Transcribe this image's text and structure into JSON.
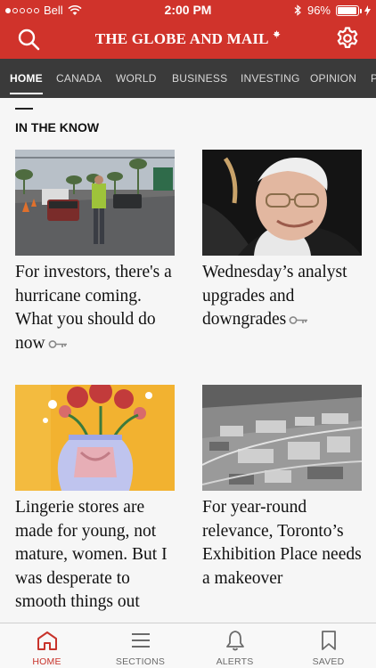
{
  "status": {
    "carrier": "Bell",
    "time": "2:00 PM",
    "battery": "96%",
    "battery_level": 0.96
  },
  "header": {
    "title": "THE GLOBE AND MAIL"
  },
  "tabs": [
    {
      "label": "HOME",
      "active": true
    },
    {
      "label": "CANADA"
    },
    {
      "label": "WORLD"
    },
    {
      "label": "BUSINESS"
    },
    {
      "label": "INVESTING"
    },
    {
      "label": "OPINION"
    },
    {
      "label": "P"
    }
  ],
  "section": {
    "title": "IN THE KNOW"
  },
  "articles": [
    {
      "headline": "For investors, there's a hurricane coming. What you should do now",
      "premium": true,
      "image": "hurricane-road-photo"
    },
    {
      "headline": "Wednesday’s analyst upgrades and downgrades",
      "premium": true,
      "image": "portrait-photo"
    },
    {
      "headline": "Lingerie stores are made for young, not mature, women. But I was desperate to smooth things out",
      "premium": false,
      "image": "lingerie-illustration"
    },
    {
      "headline": "For year-round relevance, Toronto’s Exhibition Place needs a makeover",
      "premium": false,
      "image": "aerial-photo"
    }
  ],
  "bottom_nav": [
    {
      "label": "HOME",
      "icon": "home-icon",
      "active": true
    },
    {
      "label": "SECTIONS",
      "icon": "menu-icon"
    },
    {
      "label": "ALERTS",
      "icon": "bell-icon"
    },
    {
      "label": "SAVED",
      "icon": "bookmark-icon"
    }
  ],
  "colors": {
    "brand_red": "#d0332b",
    "tab_bar": "#3a3a3a",
    "active_nav": "#c8332b"
  }
}
